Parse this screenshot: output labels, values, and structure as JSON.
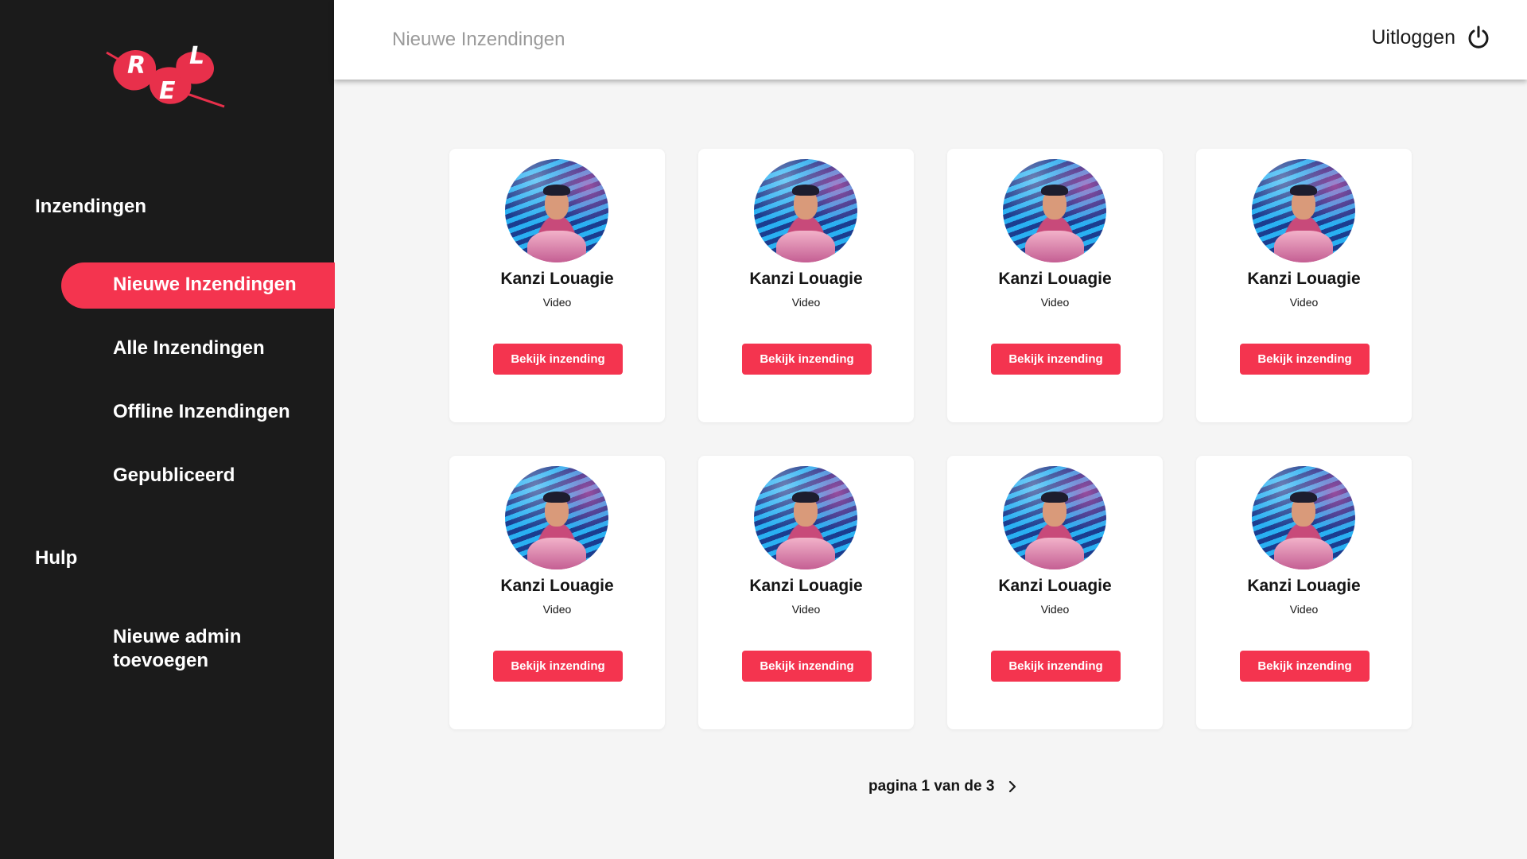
{
  "sidebar": {
    "logo_letters": [
      "R",
      "E",
      "L"
    ],
    "section_submissions": "Inzendingen",
    "items": [
      {
        "label": "Nieuwe Inzendingen",
        "active": true
      },
      {
        "label": "Alle Inzendingen",
        "active": false
      },
      {
        "label": "Offline Inzendingen",
        "active": false
      },
      {
        "label": "Gepubliceerd",
        "active": false
      }
    ],
    "section_help": "Hulp",
    "add_admin": {
      "line1": "Nieuwe admin",
      "line2": "toevoegen"
    }
  },
  "header": {
    "title": "Nieuwe Inzendingen",
    "logout_label": "Uitloggen",
    "logout_icon": "power-icon"
  },
  "cards": [
    {
      "name": "Kanzi Louagie",
      "type": "Video",
      "button": "Bekijk inzending"
    },
    {
      "name": "Kanzi Louagie",
      "type": "Video",
      "button": "Bekijk inzending"
    },
    {
      "name": "Kanzi Louagie",
      "type": "Video",
      "button": "Bekijk inzending"
    },
    {
      "name": "Kanzi Louagie",
      "type": "Video",
      "button": "Bekijk inzending"
    },
    {
      "name": "Kanzi Louagie",
      "type": "Video",
      "button": "Bekijk inzending"
    },
    {
      "name": "Kanzi Louagie",
      "type": "Video",
      "button": "Bekijk inzending"
    },
    {
      "name": "Kanzi Louagie",
      "type": "Video",
      "button": "Bekijk inzending"
    },
    {
      "name": "Kanzi Louagie",
      "type": "Video",
      "button": "Bekijk inzending"
    }
  ],
  "pagination": {
    "label": "pagina 1 van de 3",
    "next_icon": "chevron-right-icon"
  },
  "colors": {
    "accent": "#f4344f",
    "sidebar_bg": "#1b1b1b",
    "content_bg": "#f5f5f5"
  }
}
